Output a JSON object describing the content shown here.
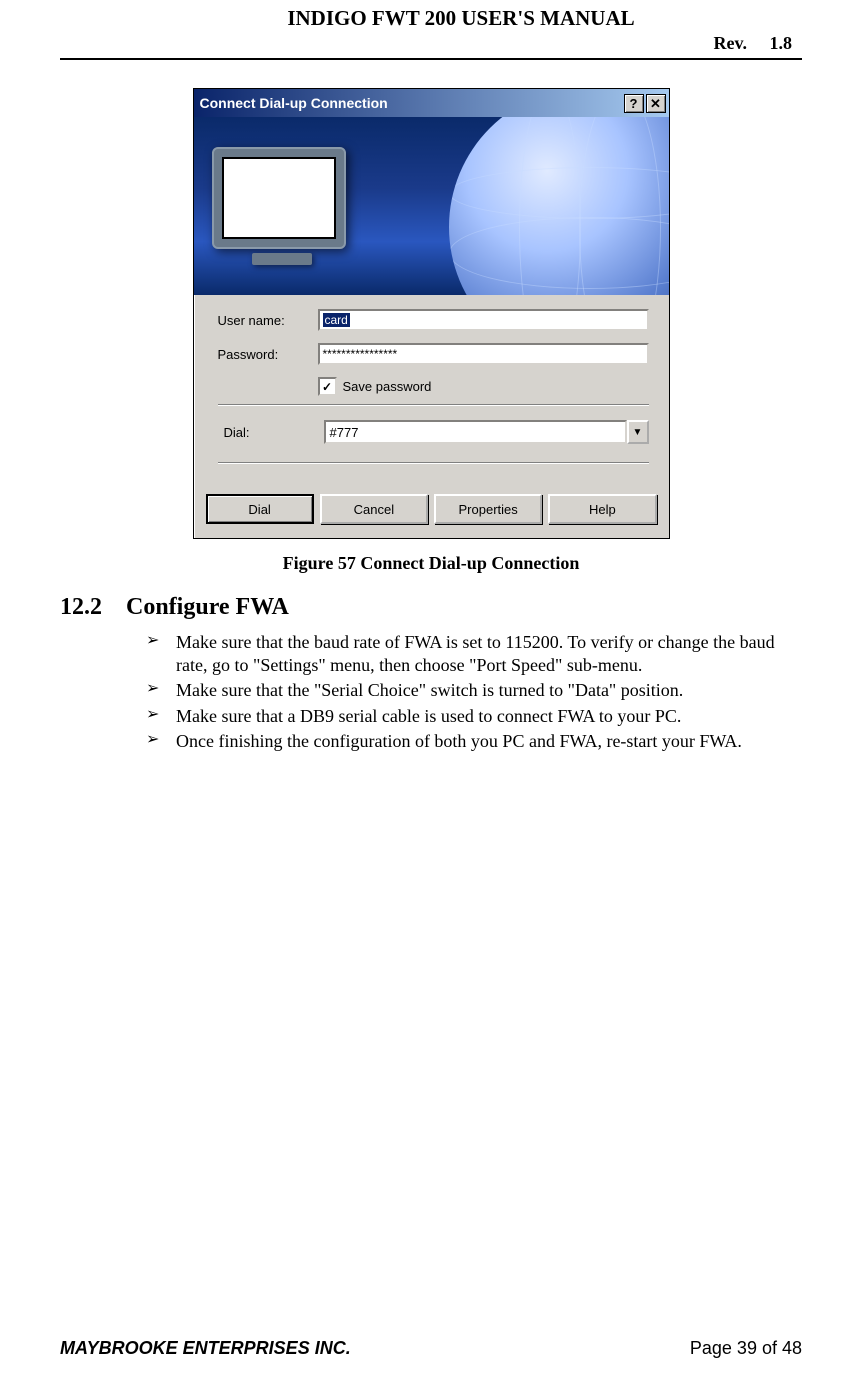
{
  "header": {
    "title": "INDIGO FWT 200 USER'S MANUAL",
    "rev_label": "Rev.",
    "rev_value": "1.8"
  },
  "dialog": {
    "title": "Connect Dial-up Connection",
    "help_btn": "?",
    "close_btn": "✕",
    "username_label": "User name:",
    "username_value": "card",
    "password_label": "Password:",
    "password_value": "****************",
    "save_password_label": "Save password",
    "save_password_checked": "✓",
    "dial_label": "Dial:",
    "dial_value": "#777",
    "combo_arrow": "▼",
    "buttons": {
      "dial": "Dial",
      "cancel": "Cancel",
      "properties": "Properties",
      "help": "Help"
    }
  },
  "figure_caption": "Figure 57 Connect Dial-up Connection",
  "section": {
    "number": "12.2",
    "title": "Configure FWA",
    "bullets": [
      "Make sure that the baud rate of FWA is set to 115200. To verify or change the baud rate, go to \"Settings\" menu,  then choose \"Port Speed\" sub-menu.",
      "Make sure that the \"Serial Choice\" switch is turned to \"Data\" position.",
      "Make sure that a DB9 serial cable is used to connect FWA to your PC.",
      "Once finishing the configuration of both you PC and FWA, re-start your FWA."
    ]
  },
  "footer": {
    "company": "MAYBROOKE ENTERPRISES INC.",
    "page": "Page 39 of 48"
  }
}
